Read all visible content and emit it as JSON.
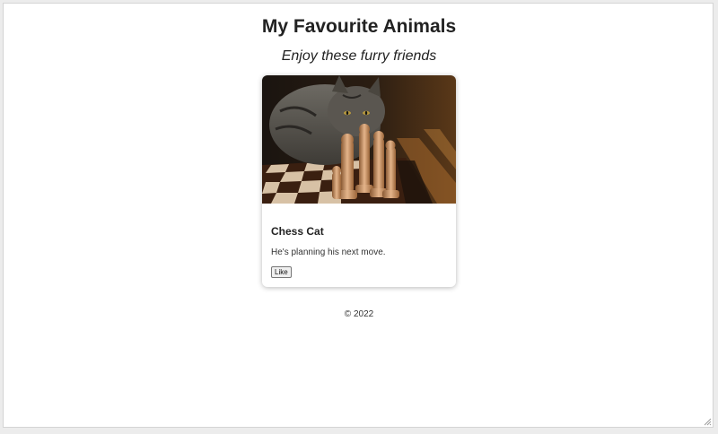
{
  "header": {
    "title": "My Favourite Animals",
    "subtitle": "Enjoy these furry friends"
  },
  "card": {
    "image_subject": "cat-with-chess-pieces",
    "title": "Chess Cat",
    "description": "He's planning his next move.",
    "like_label": "Like"
  },
  "footer": {
    "text": "© 2022"
  },
  "colors": {
    "page_background": "#ffffff",
    "text": "#222222",
    "card_shadow": "rgba(0,0,0,0.28)"
  }
}
